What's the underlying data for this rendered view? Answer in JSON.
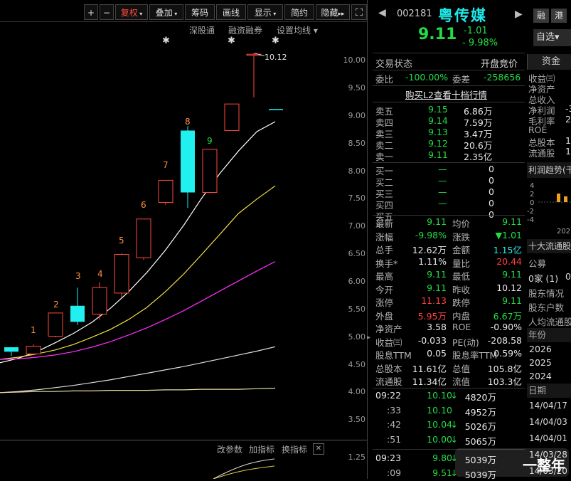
{
  "toolbar": {
    "plus": "+",
    "minus": "−",
    "fuquan": "复权",
    "overlay": "叠加",
    "chips": "筹码",
    "draw": "画线",
    "display": "显示",
    "brief": "简约",
    "hide": "隐藏",
    "fullscreen": "⛶"
  },
  "chart_links": {
    "shengutong": "深股通",
    "margin": "融资融券",
    "ma_settings": "设置均线"
  },
  "chart": {
    "type": "candlestick",
    "y_ticks": [
      "10.00",
      "9.50",
      "9.00",
      "8.50",
      "8.00",
      "7.50",
      "7.00",
      "6.50",
      "6.00",
      "5.50",
      "5.00",
      "4.50",
      "4.00",
      "3.50"
    ],
    "high_label": "10.12",
    "day_numbers": [
      "1",
      "2",
      "3",
      "4",
      "5",
      "6",
      "7",
      "8",
      "9"
    ],
    "candles": [
      {
        "o": 4.72,
        "h": 4.8,
        "l": 4.64,
        "c": 4.8,
        "color": "cyan"
      },
      {
        "o": 4.68,
        "h": 4.85,
        "l": 4.66,
        "c": 4.82,
        "color": "red"
      },
      {
        "o": 5.0,
        "h": 5.42,
        "l": 4.98,
        "c": 5.42,
        "color": "red"
      },
      {
        "o": 5.26,
        "h": 5.88,
        "l": 5.2,
        "c": 5.55,
        "color": "cyan"
      },
      {
        "o": 5.4,
        "h": 5.98,
        "l": 5.3,
        "c": 5.88,
        "color": "red"
      },
      {
        "o": 5.78,
        "h": 6.5,
        "l": 5.7,
        "c": 6.48,
        "color": "red"
      },
      {
        "o": 6.42,
        "h": 7.12,
        "l": 6.38,
        "c": 7.12,
        "color": "red"
      },
      {
        "o": 7.42,
        "h": 7.82,
        "l": 7.38,
        "c": 7.82,
        "color": "red"
      },
      {
        "o": 8.72,
        "h": 8.8,
        "l": 7.32,
        "c": 7.6,
        "color": "cyan"
      },
      {
        "o": 7.6,
        "h": 8.38,
        "l": 7.6,
        "c": 8.38,
        "color": "red"
      },
      {
        "o": 8.72,
        "h": 9.2,
        "l": 8.72,
        "c": 9.2,
        "color": "red"
      },
      {
        "o": 10.1,
        "h": 10.12,
        "l": 9.32,
        "c": 10.1,
        "color": "red"
      },
      {
        "o": 9.11,
        "h": 9.11,
        "l": 9.11,
        "c": 9.11,
        "color": "cyan"
      }
    ],
    "ma_lines": [
      {
        "color": "#ffffff",
        "y": [
          4.52,
          4.6,
          4.72,
          4.88,
          5.05,
          5.25,
          5.5,
          5.8,
          6.15,
          6.55,
          7.0,
          7.5,
          7.95,
          8.35,
          8.7,
          8.88
        ]
      },
      {
        "color": "#f0e040",
        "y": [
          4.58,
          4.62,
          4.68,
          4.75,
          4.85,
          4.98,
          5.12,
          5.3,
          5.52,
          5.8,
          6.12,
          6.48,
          6.85,
          7.22,
          7.48,
          7.72
        ]
      },
      {
        "color": "#ff30ff",
        "y": [
          4.58,
          4.59,
          4.62,
          4.66,
          4.72,
          4.8,
          4.9,
          5.02,
          5.15,
          5.3,
          5.46,
          5.64,
          5.82,
          6.0,
          6.18,
          6.35
        ]
      },
      {
        "color": "#e0e0e0",
        "y": [
          3.98,
          4.0,
          4.03,
          4.07,
          4.11,
          4.16,
          4.21,
          4.27,
          4.33,
          4.39,
          4.45,
          4.52,
          4.59,
          4.66,
          4.73,
          4.81
        ]
      },
      {
        "color": "#e8e0a0",
        "y": [
          3.98,
          3.99,
          4.0,
          4.0,
          4.01,
          4.01,
          4.02,
          4.02,
          4.02,
          4.03,
          4.03,
          4.04,
          4.04,
          4.04,
          4.05,
          4.06
        ]
      }
    ]
  },
  "indicator_bar": {
    "params": "改参数",
    "add": "加指标",
    "switch": "换指标",
    "close": "✕",
    "tick": "1.25"
  },
  "stock": {
    "code": "002181",
    "name": "粤传媒",
    "price": "9.11",
    "change": "-1.01",
    "pct": "- 9.98%",
    "margin_tag": "融",
    "hk_tag": "港",
    "watch": "自选",
    "watch_arrow": "▾"
  },
  "status": {
    "label": "交易状态",
    "value": "开盘竞价",
    "tab": "资金"
  },
  "ratio": {
    "wb_label": "委比",
    "wb": "-100.00%",
    "wc_label": "委差",
    "wc": "-258656"
  },
  "l2": "购买L2查看十档行情",
  "asks": [
    {
      "label": "卖五",
      "price": "9.15",
      "vol": "6.86万"
    },
    {
      "label": "卖四",
      "price": "9.14",
      "vol": "7.59万"
    },
    {
      "label": "卖三",
      "price": "9.13",
      "vol": "3.47万"
    },
    {
      "label": "卖二",
      "price": "9.12",
      "vol": "20.6万"
    },
    {
      "label": "卖一",
      "price": "9.11",
      "vol": "2.35亿"
    }
  ],
  "bids": [
    {
      "label": "买一",
      "price": "—",
      "vol": "0"
    },
    {
      "label": "买二",
      "price": "—",
      "vol": "0"
    },
    {
      "label": "买三",
      "price": "—",
      "vol": "0"
    },
    {
      "label": "买四",
      "price": "—",
      "vol": "0"
    },
    {
      "label": "买五",
      "price": "—",
      "vol": "0"
    }
  ],
  "quote": [
    {
      "l1": "最新",
      "v1": "9.11",
      "c1": "grn",
      "l2": "均价",
      "v2": "9.11",
      "c2": "grn"
    },
    {
      "l1": "涨幅",
      "v1": "-9.98%",
      "c1": "grn",
      "l2": "涨跌",
      "v2": "▼1.01",
      "c2": "grn"
    },
    {
      "l1": "总手",
      "v1": "12.62万",
      "c1": "wht",
      "l2": "金额",
      "v2": "1.15亿",
      "c2": "cyn"
    },
    {
      "l1": "换手*",
      "v1": "1.11%",
      "c1": "wht",
      "l2": "量比",
      "v2": "20.44",
      "c2": "red"
    },
    {
      "l1": "最高",
      "v1": "9.11",
      "c1": "grn",
      "l2": "最低",
      "v2": "9.11",
      "c2": "grn"
    },
    {
      "l1": "今开",
      "v1": "9.11",
      "c1": "grn",
      "l2": "昨收",
      "v2": "10.12",
      "c2": "wht"
    },
    {
      "l1": "涨停",
      "v1": "11.13",
      "c1": "red",
      "l2": "跌停",
      "v2": "9.11",
      "c2": "grn"
    },
    {
      "l1": "外盘",
      "v1": "5.95万",
      "c1": "red",
      "l2": "内盘",
      "v2": "6.67万",
      "c2": "grn"
    },
    {
      "l1": "净资产",
      "v1": "3.58",
      "c1": "wht",
      "l2": "ROE",
      "v2": "-0.90%",
      "c2": "wht"
    },
    {
      "l1": "收益㈢",
      "v1": "-0.033",
      "c1": "wht",
      "l2": "PE(动)",
      "v2": "-208.58",
      "c2": "wht"
    },
    {
      "l1": "股息TTM",
      "v1": "0.05",
      "c1": "wht",
      "l2": "股息率TTM",
      "v2": "0.59%",
      "c2": "wht"
    },
    {
      "l1": "总股本",
      "v1": "11.61亿",
      "c1": "wht",
      "l2": "总值",
      "v2": "105.8亿",
      "c2": "wht"
    },
    {
      "l1": "流通股",
      "v1": "11.34亿",
      "c1": "wht",
      "l2": "流值",
      "v2": "103.3亿",
      "c2": "wht"
    }
  ],
  "ticks": [
    {
      "time": "09:22",
      "price": "10.10",
      "arrow": "↓",
      "vol": "4820万"
    },
    {
      "time": ":33",
      "price": "10.10",
      "arrow": "",
      "vol": "4952万"
    },
    {
      "time": ":42",
      "price": "10.04",
      "arrow": "↓",
      "vol": "5026万"
    },
    {
      "time": ":51",
      "price": "10.00",
      "arrow": "↓",
      "vol": "5065万"
    },
    {
      "time": "09:23",
      "price": "9.80",
      "arrow": "↓",
      "vol": "5039万"
    },
    {
      "time": ":09",
      "price": "9.51",
      "arrow": "↓",
      "vol": "5039万"
    }
  ],
  "side_panel": {
    "items1": [
      "收益㈢",
      "净资产",
      "总收入",
      "净利润",
      "毛利率",
      "ROE",
      "总股本",
      "流通股"
    ],
    "vals1": [
      "",
      "",
      "",
      "-3",
      "2",
      "",
      "1",
      "1"
    ],
    "profit_trend": "利润趋势(千",
    "trend_ticks": [
      "4",
      "2",
      "0",
      "-2",
      "-4"
    ],
    "trend_year": "202",
    "top_holders": "十大流通股",
    "notice": "公募",
    "count": "0家 (1)",
    "count_val": "0",
    "holder_info": "股东情况",
    "holder_count": "股东户数",
    "per_capita": "人均流通股",
    "year_header": "年份",
    "years": [
      "2026",
      "2025",
      "2024"
    ],
    "date_header": "日期",
    "dates": [
      "14/04/17",
      "14/04/03",
      "14/04/01",
      "14/03/28",
      "14/03/20"
    ]
  },
  "watermark": "一整年"
}
